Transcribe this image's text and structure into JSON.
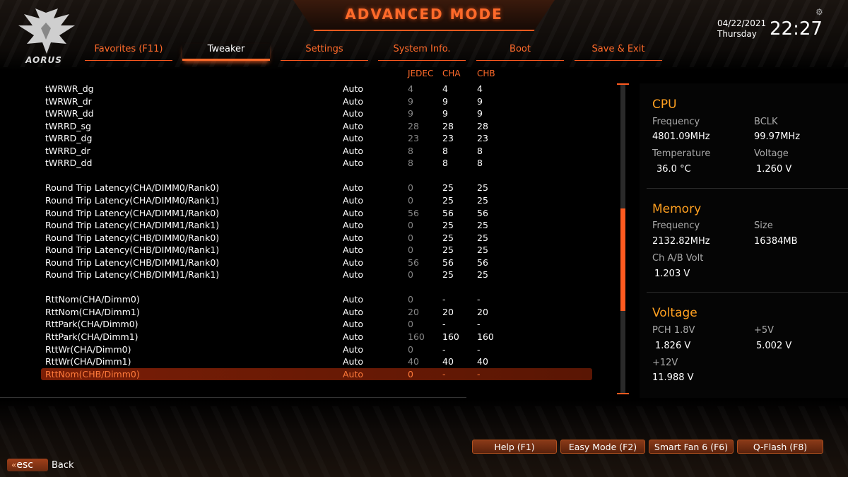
{
  "header": {
    "title": "ADVANCED MODE",
    "logo_text": "AORUS",
    "date": "04/22/2021",
    "weekday": "Thursday",
    "time": "22:27",
    "settings_icon": "gear-icon"
  },
  "tabs": [
    {
      "label": "Favorites (F11)",
      "active": false
    },
    {
      "label": "Tweaker",
      "active": true
    },
    {
      "label": "Settings",
      "active": false
    },
    {
      "label": "System Info.",
      "active": false
    },
    {
      "label": "Boot",
      "active": false
    },
    {
      "label": "Save & Exit",
      "active": false
    }
  ],
  "columns": {
    "jedec": "JEDEC",
    "cha": "CHA",
    "chb": "CHB"
  },
  "rows": [
    {
      "name": "tWRWR_dg",
      "value": "Auto",
      "jedec": "4",
      "cha": "4",
      "chb": "4"
    },
    {
      "name": "tWRWR_dr",
      "value": "Auto",
      "jedec": "9",
      "cha": "9",
      "chb": "9"
    },
    {
      "name": "tWRWR_dd",
      "value": "Auto",
      "jedec": "9",
      "cha": "9",
      "chb": "9"
    },
    {
      "name": "tWRRD_sg",
      "value": "Auto",
      "jedec": "28",
      "cha": "28",
      "chb": "28"
    },
    {
      "name": "tWRRD_dg",
      "value": "Auto",
      "jedec": "23",
      "cha": "23",
      "chb": "23"
    },
    {
      "name": "tWRRD_dr",
      "value": "Auto",
      "jedec": "8",
      "cha": "8",
      "chb": "8"
    },
    {
      "name": "tWRRD_dd",
      "value": "Auto",
      "jedec": "8",
      "cha": "8",
      "chb": "8"
    },
    {
      "name": "Round Trip Latency(CHA/DIMM0/Rank0)",
      "value": "Auto",
      "jedec": "0",
      "cha": "25",
      "chb": "25"
    },
    {
      "name": "Round Trip Latency(CHA/DIMM0/Rank1)",
      "value": "Auto",
      "jedec": "0",
      "cha": "25",
      "chb": "25"
    },
    {
      "name": "Round Trip Latency(CHA/DIMM1/Rank0)",
      "value": "Auto",
      "jedec": "56",
      "cha": "56",
      "chb": "56"
    },
    {
      "name": "Round Trip Latency(CHA/DIMM1/Rank1)",
      "value": "Auto",
      "jedec": "0",
      "cha": "25",
      "chb": "25"
    },
    {
      "name": "Round Trip Latency(CHB/DIMM0/Rank0)",
      "value": "Auto",
      "jedec": "0",
      "cha": "25",
      "chb": "25"
    },
    {
      "name": "Round Trip Latency(CHB/DIMM0/Rank1)",
      "value": "Auto",
      "jedec": "0",
      "cha": "25",
      "chb": "25"
    },
    {
      "name": "Round Trip Latency(CHB/DIMM1/Rank0)",
      "value": "Auto",
      "jedec": "56",
      "cha": "56",
      "chb": "56"
    },
    {
      "name": "Round Trip Latency(CHB/DIMM1/Rank1)",
      "value": "Auto",
      "jedec": "0",
      "cha": "25",
      "chb": "25"
    },
    {
      "name": "RttNom(CHA/Dimm0)",
      "value": "Auto",
      "jedec": "0",
      "cha": "-",
      "chb": "-"
    },
    {
      "name": "RttNom(CHA/Dimm1)",
      "value": "Auto",
      "jedec": "20",
      "cha": "20",
      "chb": "20"
    },
    {
      "name": "RttPark(CHA/Dimm0)",
      "value": "Auto",
      "jedec": "0",
      "cha": "-",
      "chb": "-"
    },
    {
      "name": "RttPark(CHA/Dimm1)",
      "value": "Auto",
      "jedec": "160",
      "cha": "160",
      "chb": "160"
    },
    {
      "name": "RttWr(CHA/Dimm0)",
      "value": "Auto",
      "jedec": "0",
      "cha": "-",
      "chb": "-"
    },
    {
      "name": "RttWr(CHA/Dimm1)",
      "value": "Auto",
      "jedec": "40",
      "cha": "40",
      "chb": "40"
    },
    {
      "name": "RttNom(CHB/Dimm0)",
      "value": "Auto",
      "jedec": "0",
      "cha": "-",
      "chb": "-",
      "selected": true
    }
  ],
  "scroll_position": 0.6,
  "info": {
    "cpu": {
      "title": "CPU",
      "frequency_label": "Frequency",
      "frequency": "4801.09MHz",
      "bclk_label": "BCLK",
      "bclk": "99.97MHz",
      "temperature_label": "Temperature",
      "temperature": "36.0 °C",
      "voltage_label": "Voltage",
      "voltage": "1.260 V"
    },
    "memory": {
      "title": "Memory",
      "frequency_label": "Frequency",
      "frequency": "2132.82MHz",
      "size_label": "Size",
      "size": "16384MB",
      "volt_label": "Ch A/B Volt",
      "volt": "1.203 V"
    },
    "voltage": {
      "title": "Voltage",
      "pch_label": "PCH 1.8V",
      "pch": "1.826 V",
      "p5v_label": "+5V",
      "p5v": "5.002 V",
      "p12v_label": "+12V",
      "p12v": "11.988 V"
    }
  },
  "footer": {
    "help": "Help (F1)",
    "easy_mode": "Easy Mode (F2)",
    "smart_fan": "Smart Fan 6 (F6)",
    "qflash": "Q-Flash (F8)",
    "esc_key": "esc",
    "back": "Back"
  },
  "colors": {
    "accent": "#ff6a2a",
    "section_title": "#ffa020",
    "selected_row": "#7a1e06"
  }
}
